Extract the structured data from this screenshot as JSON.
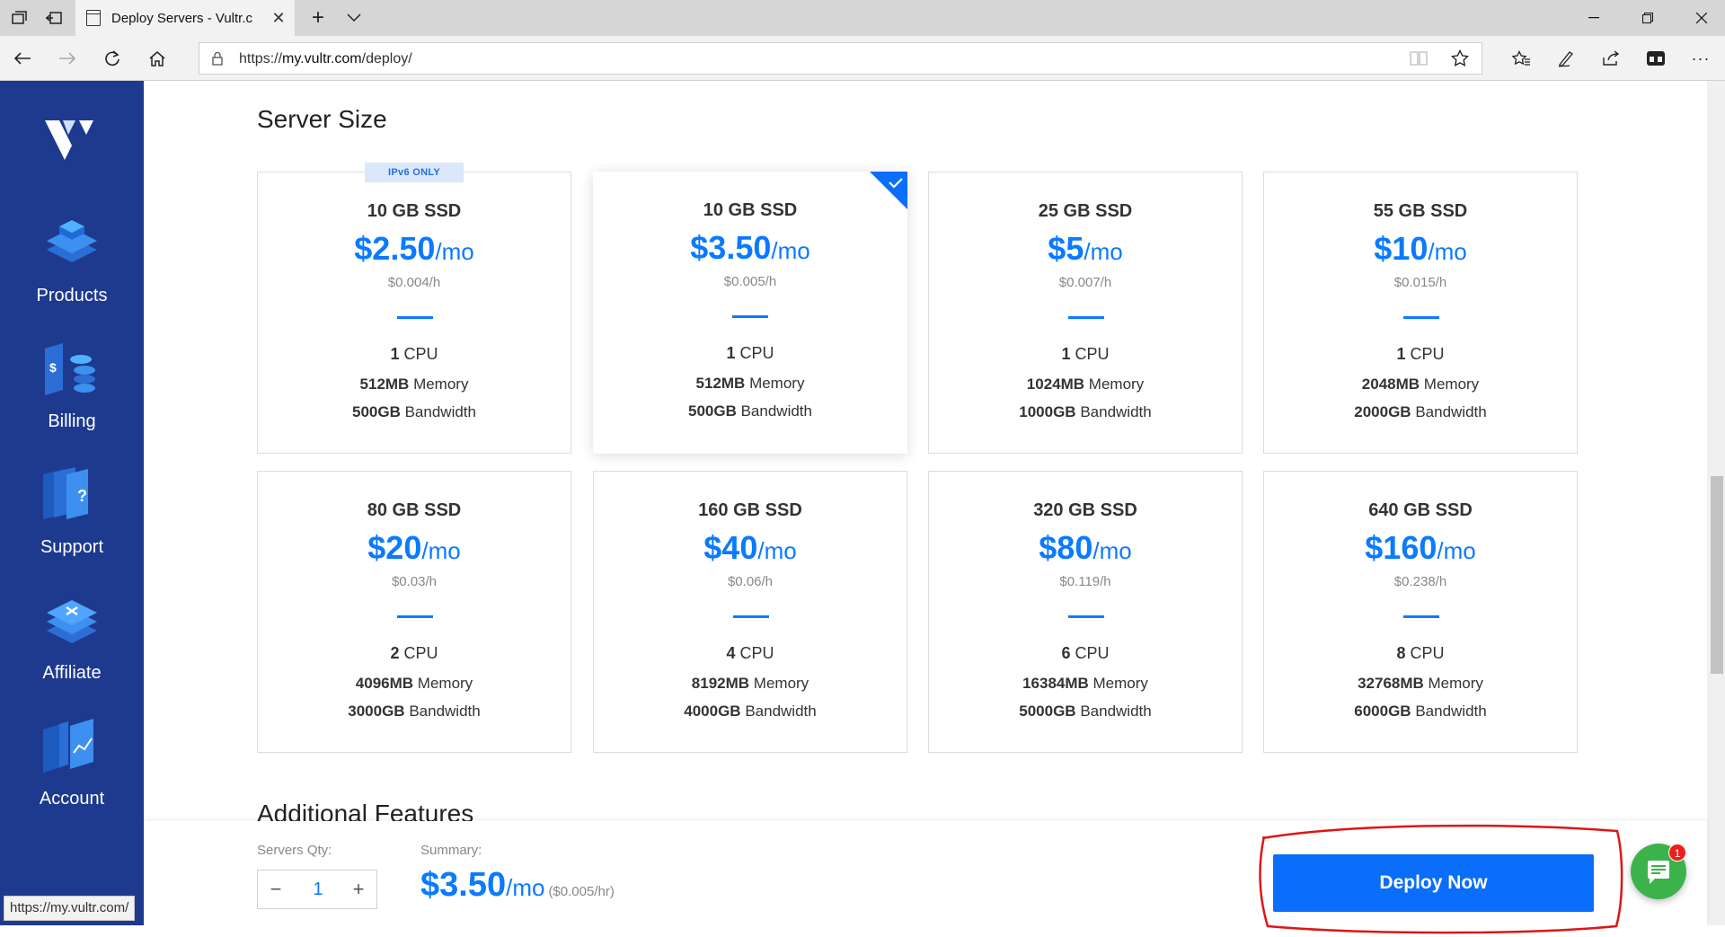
{
  "browser": {
    "tab_title": "Deploy Servers - Vultr.c",
    "url_protocol": "https://",
    "url_host": "my.vultr.com",
    "url_path": "/deploy/",
    "status_url": "https://my.vultr.com/"
  },
  "sidebar": {
    "items": [
      {
        "label": "Products",
        "icon": "products-icon"
      },
      {
        "label": "Billing",
        "icon": "billing-icon"
      },
      {
        "label": "Support",
        "icon": "support-icon"
      },
      {
        "label": "Affiliate",
        "icon": "affiliate-icon"
      },
      {
        "label": "Account",
        "icon": "account-icon"
      }
    ]
  },
  "main": {
    "server_size_title": "Server Size",
    "additional_features_title": "Additional Features",
    "ipv6_badge": "IPv6 ONLY",
    "per_month": "/mo",
    "cards": [
      {
        "storage": "10 GB SSD",
        "price": "$2.50",
        "hourly": "$0.004/h",
        "cpu_num": "1",
        "cpu_unit": " CPU",
        "mem_num": "512MB",
        "mem_unit": " Memory",
        "bw_num": "500GB",
        "bw_unit": " Bandwidth",
        "ipv6_only": true,
        "selected": false
      },
      {
        "storage": "10 GB SSD",
        "price": "$3.50",
        "hourly": "$0.005/h",
        "cpu_num": "1",
        "cpu_unit": " CPU",
        "mem_num": "512MB",
        "mem_unit": " Memory",
        "bw_num": "500GB",
        "bw_unit": " Bandwidth",
        "ipv6_only": false,
        "selected": true
      },
      {
        "storage": "25 GB SSD",
        "price": "$5",
        "hourly": "$0.007/h",
        "cpu_num": "1",
        "cpu_unit": " CPU",
        "mem_num": "1024MB",
        "mem_unit": " Memory",
        "bw_num": "1000GB",
        "bw_unit": " Bandwidth",
        "ipv6_only": false,
        "selected": false
      },
      {
        "storage": "55 GB SSD",
        "price": "$10",
        "hourly": "$0.015/h",
        "cpu_num": "1",
        "cpu_unit": " CPU",
        "mem_num": "2048MB",
        "mem_unit": " Memory",
        "bw_num": "2000GB",
        "bw_unit": " Bandwidth",
        "ipv6_only": false,
        "selected": false
      },
      {
        "storage": "80 GB SSD",
        "price": "$20",
        "hourly": "$0.03/h",
        "cpu_num": "2",
        "cpu_unit": " CPU",
        "mem_num": "4096MB",
        "mem_unit": " Memory",
        "bw_num": "3000GB",
        "bw_unit": " Bandwidth",
        "ipv6_only": false,
        "selected": false
      },
      {
        "storage": "160 GB SSD",
        "price": "$40",
        "hourly": "$0.06/h",
        "cpu_num": "4",
        "cpu_unit": " CPU",
        "mem_num": "8192MB",
        "mem_unit": " Memory",
        "bw_num": "4000GB",
        "bw_unit": " Bandwidth",
        "ipv6_only": false,
        "selected": false
      },
      {
        "storage": "320 GB SSD",
        "price": "$80",
        "hourly": "$0.119/h",
        "cpu_num": "6",
        "cpu_unit": " CPU",
        "mem_num": "16384MB",
        "mem_unit": " Memory",
        "bw_num": "5000GB",
        "bw_unit": " Bandwidth",
        "ipv6_only": false,
        "selected": false
      },
      {
        "storage": "640 GB SSD",
        "price": "$160",
        "hourly": "$0.238/h",
        "cpu_num": "8",
        "cpu_unit": " CPU",
        "mem_num": "32768MB",
        "mem_unit": " Memory",
        "bw_num": "6000GB",
        "bw_unit": " Bandwidth",
        "ipv6_only": false,
        "selected": false
      }
    ]
  },
  "deploy_bar": {
    "qty_label": "Servers Qty:",
    "qty_value": "1",
    "minus": "−",
    "plus": "+",
    "summary_label": "Summary:",
    "summary_price": "$3.50",
    "summary_per": "/mo",
    "summary_hourly": "($0.005/hr)",
    "deploy_label": "Deploy Now",
    "chat_badge": "1"
  },
  "colors": {
    "accent": "#0a7aff",
    "sidebar": "#1e3a8f",
    "deploy_button": "#0a6efa",
    "chat": "#3bb34a",
    "annotation": "#e01414"
  }
}
